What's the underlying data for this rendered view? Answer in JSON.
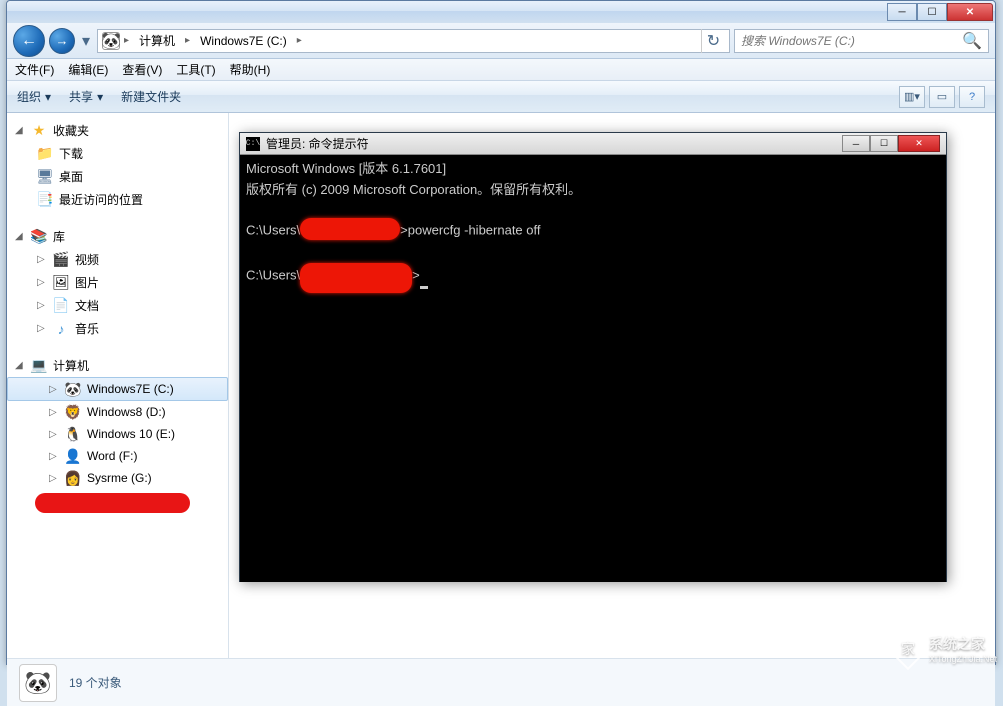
{
  "explorer": {
    "breadcrumb": {
      "segments": [
        "计算机",
        "Windows7E (C:)"
      ],
      "icon": "panda"
    },
    "search": {
      "placeholder": "搜索 Windows7E (C:)"
    },
    "menu": [
      "文件(F)",
      "编辑(E)",
      "查看(V)",
      "工具(T)",
      "帮助(H)"
    ],
    "toolbar": {
      "organize": "组织",
      "share": "共享",
      "newfolder": "新建文件夹"
    },
    "sidebar": {
      "favorites": {
        "label": "收藏夹",
        "items": [
          "下载",
          "桌面",
          "最近访问的位置"
        ]
      },
      "libraries": {
        "label": "库",
        "items": [
          "视频",
          "图片",
          "文档",
          "音乐"
        ]
      },
      "computer": {
        "label": "计算机",
        "items": [
          "Windows7E (C:)",
          "Windows8 (D:)",
          "Windows 10 (E:)",
          "Word (F:)",
          "Sysrme (G:)"
        ]
      }
    },
    "status": {
      "count": "19 个对象"
    }
  },
  "cmd": {
    "title": "管理员: 命令提示符",
    "line1": "Microsoft Windows [版本 6.1.7601]",
    "line2": "版权所有 (c) 2009 Microsoft Corporation。保留所有权利。",
    "prompt1_pre": "C:\\Users\\",
    "prompt1_post": ">powercfg -hibernate off",
    "prompt2_pre": "C:\\Users\\",
    "prompt2_post": ">"
  },
  "watermark": {
    "text": "系统之家",
    "sub": "XiTongZhiJia.Net"
  }
}
